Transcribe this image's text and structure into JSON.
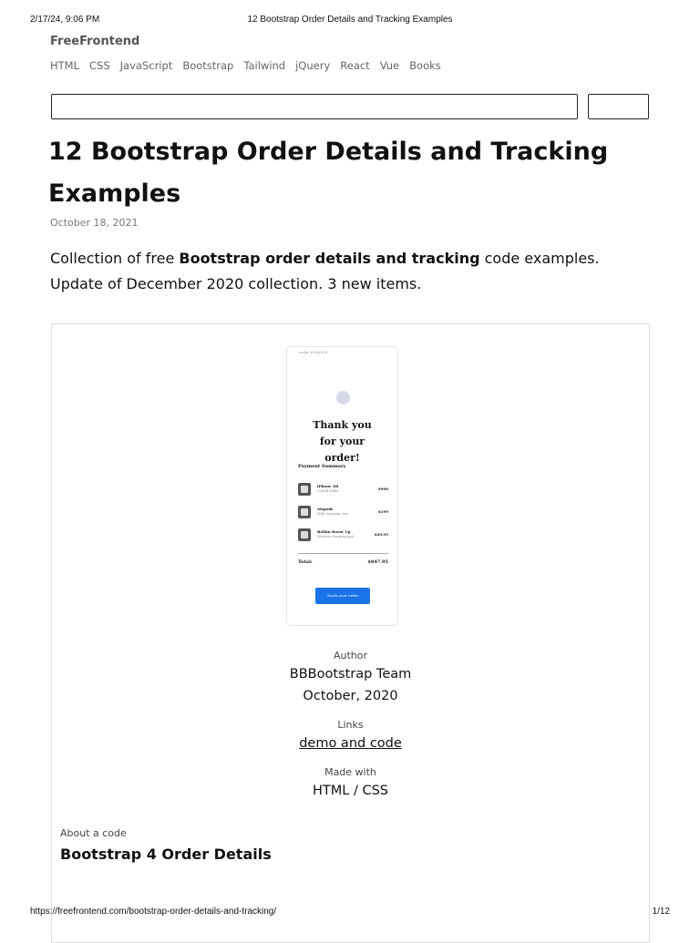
{
  "print": {
    "datetime": "2/17/24, 9:06 PM",
    "doc_title": "12 Bootstrap Order Details and Tracking Examples",
    "url": "https://freefrontend.com/bootstrap-order-details-and-tracking/",
    "page_indicator": "1/12"
  },
  "site": {
    "brand": "FreeFrontend",
    "nav": [
      "HTML",
      "CSS",
      "JavaScript",
      "Bootstrap",
      "Tailwind",
      "jQuery",
      "React",
      "Vue",
      "Books"
    ]
  },
  "search": {
    "placeholder": "",
    "button_label": ""
  },
  "article": {
    "title": "12 Bootstrap Order Details and Tracking Examples",
    "date": "October 18, 2021",
    "intro_before": "Collection of free ",
    "intro_bold": "Bootstrap order details and tracking",
    "intro_after": " code examples. Update of December 2020 collection. 3 new items."
  },
  "card": {
    "preview": {
      "order_no": "order #546924",
      "thanks": "Thank you for your order!",
      "summary_label": "Payment Summary",
      "items": [
        {
          "name": "iPhone XR",
          "sub": "128GB White",
          "price": "$998"
        },
        {
          "name": "Airpods",
          "sub": "With charging case",
          "price": "$199"
        },
        {
          "name": "Belkin Boost Up",
          "sub": "Wireless charging pad",
          "price": "$49.95"
        }
      ],
      "total_label": "Total:",
      "total_value": "$847.95",
      "button_label": "Track your order"
    },
    "author_label": "Author",
    "author": "BBBootstrap Team",
    "author_date": "October, 2020",
    "links_label": "Links",
    "link_text": "demo and code",
    "made_label": "Made with",
    "made_with": "HTML / CSS",
    "about_label": "About a code",
    "about_title": "Bootstrap 4 Order Details"
  }
}
